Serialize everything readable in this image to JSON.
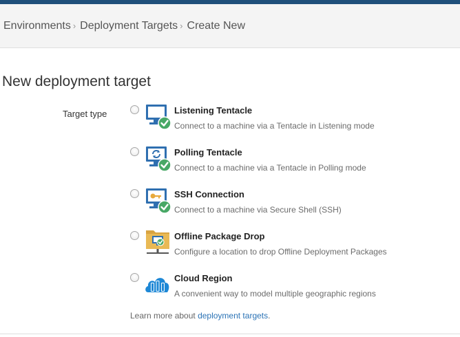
{
  "breadcrumb": {
    "items": [
      "Environments",
      "Deployment Targets",
      "Create New"
    ],
    "separator": "›"
  },
  "page": {
    "title": "New deployment target",
    "field_label": "Target type"
  },
  "options": [
    {
      "title": "Listening Tentacle",
      "description": "Connect to a machine via a Tentacle in Listening mode",
      "icon": "monitor-check-icon",
      "selected": false
    },
    {
      "title": "Polling Tentacle",
      "description": "Connect to a machine via a Tentacle in Polling mode",
      "icon": "monitor-refresh-check-icon",
      "selected": false
    },
    {
      "title": "SSH Connection",
      "description": "Connect to a machine via Secure Shell (SSH)",
      "icon": "monitor-key-check-icon",
      "selected": false
    },
    {
      "title": "Offline Package Drop",
      "description": "Configure a location to drop Offline Deployment Packages",
      "icon": "folder-monitor-check-icon",
      "selected": false
    },
    {
      "title": "Cloud Region",
      "description": "A convenient way to model multiple geographic regions",
      "icon": "cloud-servers-icon",
      "selected": false
    }
  ],
  "learn_more": {
    "prefix": "Learn more about ",
    "link_text": "deployment targets",
    "suffix": "."
  },
  "colors": {
    "top_bar": "#1f4f7a",
    "link": "#2a72b5",
    "monitor_blue": "#2f6fb0",
    "check_green": "#48a866",
    "folder_tan": "#d9a441"
  }
}
